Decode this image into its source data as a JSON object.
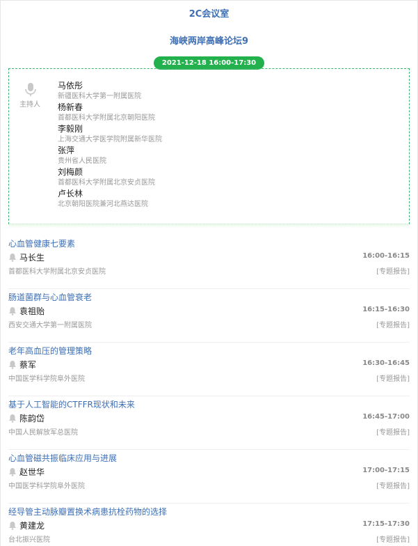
{
  "room": "2C会议室",
  "forum_title": "海峡两岸高峰论坛9",
  "time_badge": "2021-12-18 16:00-17:30",
  "host_label": "主持人",
  "hosts": [
    {
      "name": "马依彤",
      "org": "新疆医科大学第一附属医院"
    },
    {
      "name": "杨新春",
      "org": "首都医科大学附属北京朝阳医院"
    },
    {
      "name": "李毅刚",
      "org": "上海交通大学医学院附属新华医院"
    },
    {
      "name": "张萍",
      "org": "贵州省人民医院"
    },
    {
      "name": "刘梅颜",
      "org": "首都医科大学附属北京安贞医院"
    },
    {
      "name": "卢长林",
      "org": "北京朝阳医院兼河北燕达医院"
    }
  ],
  "talks": [
    {
      "title": "心血管健康七要素",
      "speaker": "马长生",
      "time": "16:00-16:15",
      "org": "首都医科大学附属北京安贞医院",
      "type": "[专题报告]"
    },
    {
      "title": "肠道菌群与心血管衰老",
      "speaker": "袁祖贻",
      "time": "16:15-16:30",
      "org": "西安交通大学第一附属医院",
      "type": "[专题报告]"
    },
    {
      "title": "老年高血压的管理策略",
      "speaker": "蔡军",
      "time": "16:30-16:45",
      "org": "中国医学科学院阜外医院",
      "type": "[专题报告]"
    },
    {
      "title": "基于人工智能的CTFFR现状和未来",
      "speaker": "陈韵岱",
      "time": "16:45-17:00",
      "org": "中国人民解放军总医院",
      "type": "[专题报告]"
    },
    {
      "title": "心血管磁共振临床应用与进展",
      "speaker": "赵世华",
      "time": "17:00-17:15",
      "org": "中国医学科学院阜外医院",
      "type": "[专题报告]"
    },
    {
      "title": "经导管主动脉瓣置换术病患抗栓药物的选择",
      "speaker": "黄建龙",
      "time": "17:15-17:30",
      "org": "台北振兴医院",
      "type": "[专题报告]"
    }
  ],
  "icons": {
    "host": "microphone-icon",
    "speaker": "bell-icon"
  },
  "colors": {
    "accent": "#3d6fb5",
    "badge": "#22b14c"
  }
}
